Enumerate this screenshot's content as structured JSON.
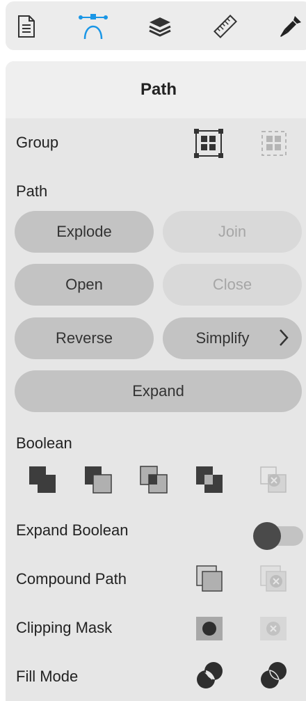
{
  "toolbar": {
    "tabs": [
      {
        "name": "document",
        "icon": "document-icon"
      },
      {
        "name": "path",
        "icon": "bezier-path-icon",
        "active": true
      },
      {
        "name": "layers",
        "icon": "layers-icon"
      },
      {
        "name": "measure",
        "icon": "ruler-icon"
      },
      {
        "name": "style",
        "icon": "brush-icon"
      }
    ],
    "active_color": "#1a96e6"
  },
  "panel": {
    "title": "Path",
    "group": {
      "label": "Group"
    },
    "path_section": {
      "label": "Path",
      "buttons": {
        "explode": "Explode",
        "join": "Join",
        "open": "Open",
        "close": "Close",
        "reverse": "Reverse",
        "simplify": "Simplify",
        "expand": "Expand"
      }
    },
    "boolean": {
      "label": "Boolean",
      "ops": [
        "union-icon",
        "subtract-icon",
        "intersect-icon",
        "exclude-icon",
        "divide-icon"
      ]
    },
    "expand_boolean": {
      "label": "Expand Boolean",
      "on": false
    },
    "compound_path": {
      "label": "Compound Path"
    },
    "clipping_mask": {
      "label": "Clipping Mask"
    },
    "fill_mode": {
      "label": "Fill Mode"
    }
  }
}
